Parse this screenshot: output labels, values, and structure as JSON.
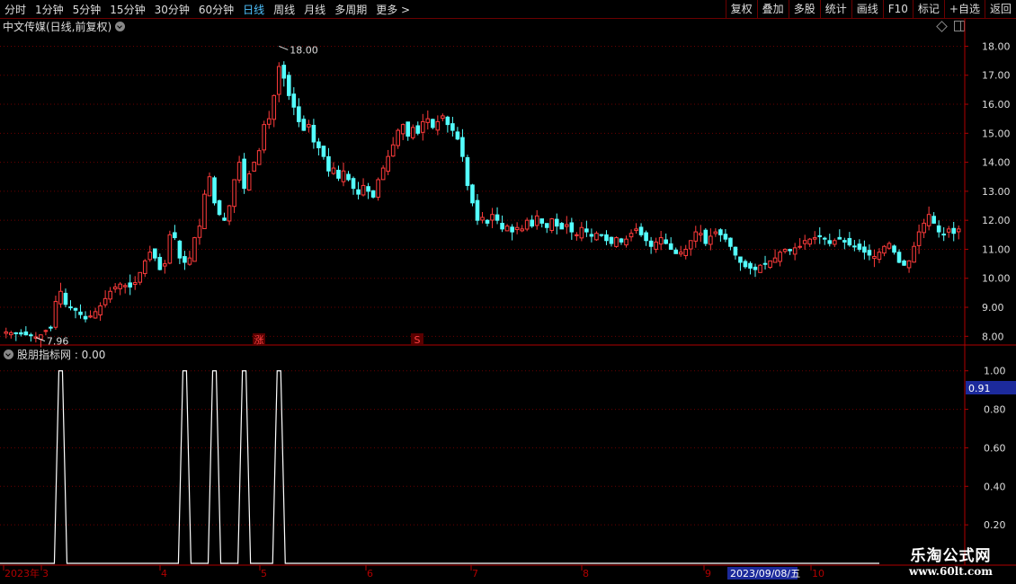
{
  "toolbar": {
    "periods": [
      "分时",
      "1分钟",
      "5分钟",
      "15分钟",
      "30分钟",
      "60分钟",
      "日线",
      "周线",
      "月线",
      "多周期",
      "更多 >"
    ],
    "active": "日线",
    "right": [
      "复权",
      "叠加",
      "多股",
      "统计",
      "画线",
      "F10",
      "标记",
      "+自选",
      "返回"
    ]
  },
  "main": {
    "title": "中文传媒(日线,前复权)",
    "y_ticks": [
      "18.00",
      "17.00",
      "16.00",
      "15.00",
      "14.00",
      "13.00",
      "12.00",
      "11.00",
      "10.00",
      "9.00",
      "8.00"
    ],
    "high_label": "18.00",
    "low_label": "7.96",
    "markers": [
      "涨",
      "S"
    ]
  },
  "indicator": {
    "title": "股朋指标网 : 0.00",
    "y_ticks": [
      "1.00",
      "0.80",
      "0.60",
      "0.40",
      "0.20"
    ],
    "current_value": "0.91"
  },
  "xaxis": {
    "labels": [
      "2023年",
      "3",
      "4",
      "5",
      "6",
      "7",
      "8",
      "9",
      "10"
    ],
    "cursor_date": "2023/09/08/五"
  },
  "watermark": {
    "line1": "乐淘公式网",
    "line2": "www.60lt.com"
  },
  "colors": {
    "up": "#ff3b3b",
    "down": "#54ffff",
    "grid": "#6b0000",
    "axis": "#b00000",
    "text": "#dddddd",
    "highlight": "#1c2a9c"
  },
  "chart_data": {
    "type": "candlestick",
    "y_range": [
      7.7,
      18.2
    ],
    "indicator_range": [
      0,
      1.05
    ],
    "closes": [
      8.15,
      8.12,
      8.1,
      8.08,
      8.05,
      8.02,
      7.98,
      8.05,
      8.2,
      8.3,
      9.2,
      9.55,
      9.1,
      9.0,
      8.9,
      8.75,
      8.6,
      8.7,
      8.85,
      9.05,
      9.3,
      9.55,
      9.7,
      9.8,
      9.75,
      9.7,
      9.85,
      10.2,
      10.6,
      10.9,
      10.7,
      10.3,
      10.5,
      11.5,
      11.4,
      10.7,
      10.55,
      10.7,
      11.4,
      11.8,
      12.9,
      13.5,
      12.6,
      12.2,
      12.0,
      12.5,
      13.4,
      14.0,
      13.1,
      13.6,
      14.0,
      14.4,
      15.3,
      15.5,
      16.3,
      17.3,
      16.9,
      16.3,
      15.9,
      15.4,
      15.1,
      15.3,
      14.7,
      14.5,
      14.2,
      13.7,
      13.8,
      13.45,
      13.7,
      13.4,
      13.1,
      12.9,
      13.2,
      13.0,
      12.8,
      13.4,
      13.8,
      14.2,
      14.6,
      15.1,
      15.3,
      14.9,
      15.2,
      15.0,
      15.4,
      15.5,
      15.2,
      15.4,
      15.6,
      15.3,
      15.1,
      14.8,
      14.2,
      13.2,
      12.6,
      12.0,
      12.1,
      11.9,
      12.2,
      12.0,
      11.7,
      11.8,
      11.6,
      11.75,
      11.7,
      12.0,
      11.8,
      12.15,
      11.9,
      11.75,
      12.05,
      11.8,
      11.7,
      11.85,
      11.6,
      11.5,
      11.75,
      11.6,
      11.45,
      11.55,
      11.5,
      11.3,
      11.2,
      11.4,
      11.25,
      11.35,
      11.55,
      11.7,
      11.5,
      11.3,
      11.1,
      11.25,
      11.4,
      11.2,
      11.0,
      10.85,
      10.9,
      11.0,
      11.3,
      11.6,
      11.55,
      11.2,
      11.45,
      11.6,
      11.5,
      11.35,
      11.1,
      10.8,
      10.55,
      10.4,
      10.35,
      10.3,
      10.45,
      10.5,
      10.6,
      10.7,
      10.9,
      11.0,
      10.95,
      11.05,
      11.1,
      11.3,
      11.35,
      11.4,
      11.45,
      11.35,
      11.2,
      11.3,
      11.35,
      11.25,
      11.15,
      11.1,
      11.0,
      10.9,
      10.8,
      10.75,
      10.9,
      11.1,
      11.2,
      10.9,
      10.55,
      10.45,
      10.6,
      11.1,
      11.6,
      11.9,
      12.2,
      11.9,
      11.6,
      11.5,
      11.7,
      11.55,
      11.7
    ],
    "indicator": {
      "baseline": 0.0,
      "peak": 1.0,
      "spikes_at_bar": [
        11,
        36,
        42,
        48,
        55
      ]
    }
  }
}
